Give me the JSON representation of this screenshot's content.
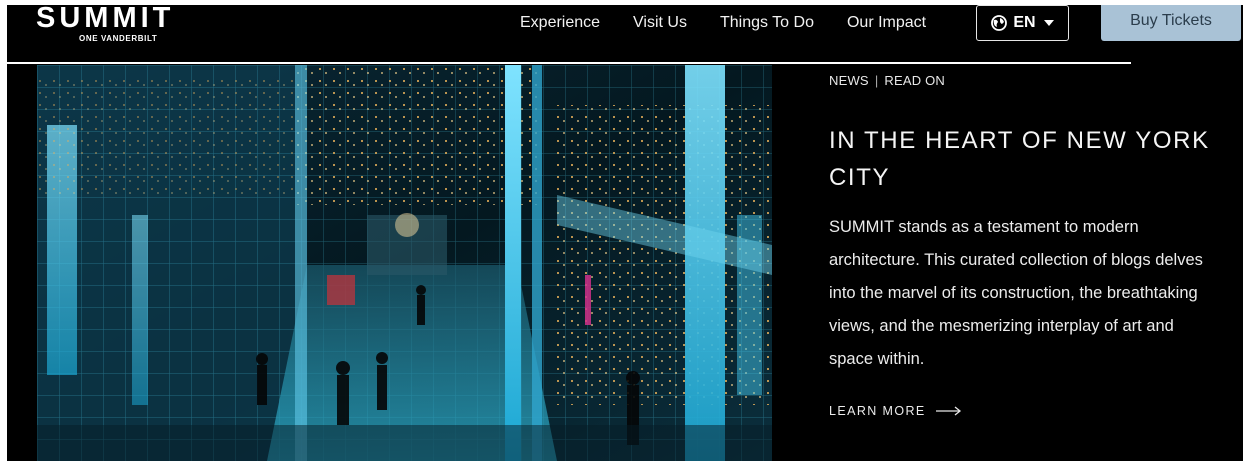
{
  "brand": {
    "logo_text": "SUMMIT",
    "logo_subtitle": "ONE VANDERBILT"
  },
  "nav": {
    "items": [
      {
        "label": "Experience"
      },
      {
        "label": "Visit Us"
      },
      {
        "label": "Things To Do"
      },
      {
        "label": "Our Impact"
      }
    ]
  },
  "language": {
    "label": "EN",
    "icon": "globe-icon"
  },
  "cta": {
    "buy_label": "Buy Tickets"
  },
  "article": {
    "category": "NEWS",
    "separator": "|",
    "kicker_link": "READ ON",
    "title": "IN THE HEART OF NEW YORK CITY",
    "body": "SUMMIT stands as a testament to modern architecture. This curated collection of blogs delves into the marvel of its construction, the breathtaking views, and the mesmerizing interplay of art and space within.",
    "learn_more": "LEARN MORE"
  },
  "colors": {
    "background": "#000000",
    "button_bg": "#a9c2d6",
    "button_text": "#2b3d4c",
    "accent_cyan": "#38c8ee"
  }
}
